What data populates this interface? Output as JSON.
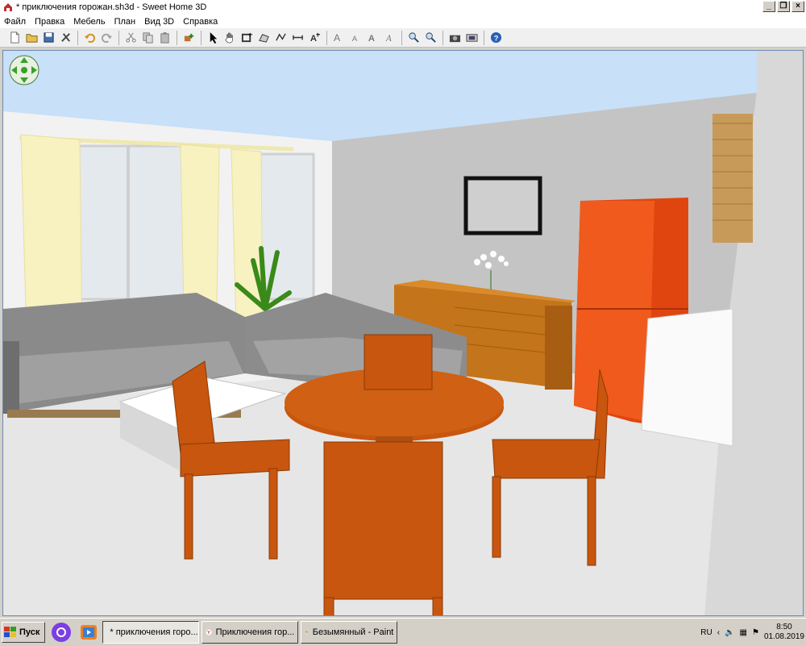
{
  "window": {
    "title": "* приключения горожан.sh3d - Sweet Home 3D",
    "minimize": "_",
    "maximize": "❐",
    "close": "×"
  },
  "menu": [
    "Файл",
    "Правка",
    "Мебель",
    "План",
    "Вид 3D",
    "Справка"
  ],
  "toolbar_icons": [
    "new-file-icon",
    "open-icon",
    "save-icon",
    "cut-tool-icon",
    "undo-icon",
    "redo-icon",
    "scissors-icon",
    "copy-icon",
    "paste-icon",
    "add-furniture-icon",
    "select-arrow-icon",
    "pan-hand-icon",
    "create-walls-icon",
    "create-rooms-icon",
    "create-polylines-icon",
    "create-dimensions-icon",
    "add-text-icon",
    "increase-text-icon",
    "decrease-text-icon",
    "bold-text-icon",
    "italic-text-icon",
    "zoom-in-icon",
    "zoom-out-icon",
    "photo-icon",
    "video-icon",
    "help-icon"
  ],
  "taskbar": {
    "start": "Пуск",
    "tasks": [
      {
        "label": "* приключения горо...",
        "active": true
      },
      {
        "label": "Приключения гор...",
        "active": false
      },
      {
        "label": "Безымянный - Paint",
        "active": false
      }
    ],
    "lang": "RU",
    "time": "8:50",
    "date": "01.08.2019"
  },
  "colors": {
    "wood": "#c8560e",
    "fridge": "#e04510",
    "sofa": "#8c8c8c",
    "curtain": "#f8f2c0"
  }
}
